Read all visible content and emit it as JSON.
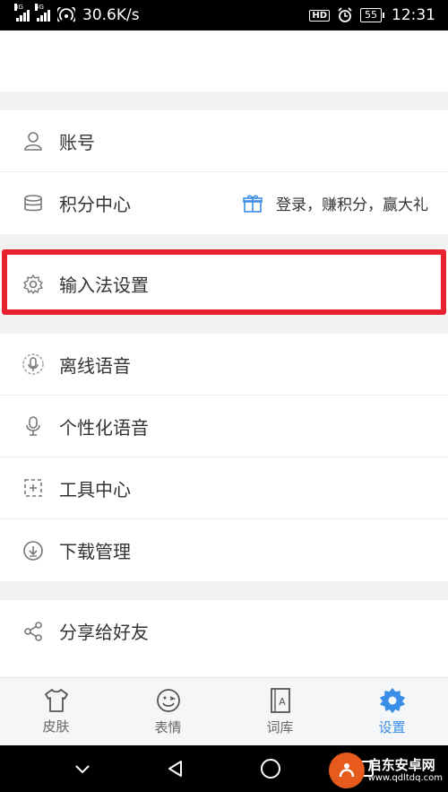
{
  "status_bar": {
    "net_speed": "30.6K/s",
    "battery": "55",
    "time": "12:31",
    "hd": "HD",
    "sig1_tag": "3G",
    "sig2_tag": "4G"
  },
  "groups": {
    "account": {
      "label": "账号"
    },
    "points": {
      "label": "积分中心",
      "hint": "登录，赚积分，赢大礼"
    },
    "ime": {
      "label": "输入法设置"
    },
    "offline": {
      "label": "离线语音"
    },
    "personal": {
      "label": "个性化语音"
    },
    "tools": {
      "label": "工具中心"
    },
    "download": {
      "label": "下载管理"
    },
    "share": {
      "label": "分享给好友"
    }
  },
  "tabs": [
    {
      "label": "皮肤"
    },
    {
      "label": "表情"
    },
    {
      "label": "词库"
    },
    {
      "label": "设置"
    }
  ],
  "colors": {
    "accent": "#3a8ee6",
    "highlight": "#e8212f"
  },
  "watermark": {
    "title": "启东安卓网",
    "url": "www.qdltdq.com"
  }
}
